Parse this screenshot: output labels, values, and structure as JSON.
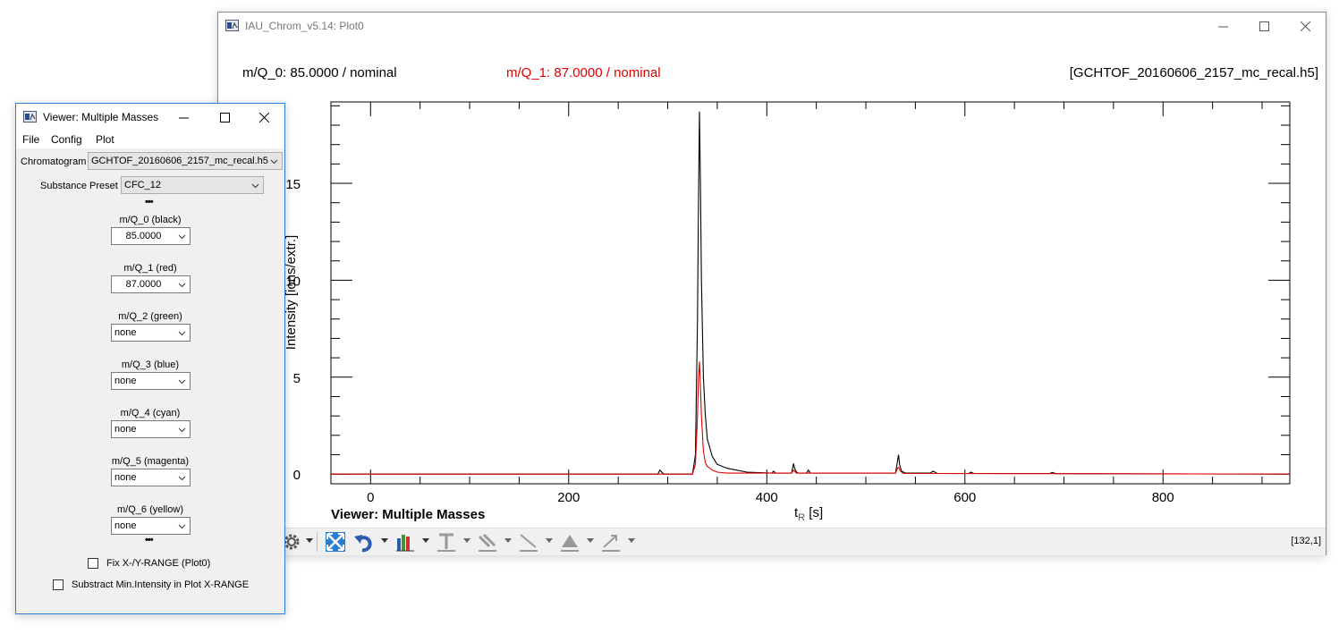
{
  "plot_window": {
    "title": "IAU_Chrom_v5.14: Plot0",
    "header": {
      "mq0_text": "m/Q_0: 85.0000 / nominal",
      "mq1_text": "m/Q_1: 87.0000 / nominal",
      "file_text": "[GCHTOF_20160606_2157_mc_recal.h5]"
    },
    "plot_caption": "Viewer: Multiple Masses",
    "xlabel_main": "t",
    "xlabel_sub": "R",
    "xlabel_unit": " [s]",
    "ylabel": "Intensity [ions/extr.]",
    "status_coords": "[132,1]",
    "colors": {
      "mq0": "#000000",
      "mq1": "#e00000"
    },
    "toolbar_icons": [
      "gear-icon",
      "zoom-fit-icon",
      "undo-icon",
      "bar-chart-icon",
      "text-tool-icon",
      "paint-tool-icon",
      "line-tool-icon",
      "shape-tool-icon",
      "arrow-tool-icon"
    ]
  },
  "chart_data": {
    "type": "line",
    "title": "",
    "xlabel": "tR [s]",
    "ylabel": "Intensity [ions/extr.]",
    "xlim": [
      -40,
      928
    ],
    "ylim": [
      -0.5,
      19.2
    ],
    "x_ticks": [
      0,
      200,
      400,
      600,
      800
    ],
    "y_ticks": [
      0,
      5,
      10,
      15
    ],
    "series": [
      {
        "name": "m/Q_0: 85.0000 / nominal",
        "color": "#000000",
        "x": [
          -40,
          290,
          292,
          294,
          296,
          325,
          328,
          330,
          331,
          332,
          333,
          334,
          336,
          338,
          340,
          345,
          350,
          360,
          380,
          405,
          407,
          409,
          425,
          427,
          428,
          430,
          432,
          440,
          442,
          444,
          530,
          532,
          533,
          534,
          536,
          540,
          565,
          568,
          572,
          604,
          606,
          609,
          686,
          688,
          692,
          928
        ],
        "y": [
          0.0,
          0.0,
          0.2,
          0.1,
          0.0,
          0.0,
          1.0,
          8.0,
          14.0,
          18.7,
          15.0,
          10.0,
          5.0,
          3.0,
          1.8,
          0.9,
          0.5,
          0.3,
          0.1,
          0.05,
          0.15,
          0.05,
          0.05,
          0.55,
          0.3,
          0.1,
          0.05,
          0.05,
          0.2,
          0.05,
          0.05,
          0.7,
          1.0,
          0.5,
          0.15,
          0.05,
          0.05,
          0.15,
          0.03,
          0.03,
          0.1,
          0.03,
          0.03,
          0.08,
          0.02,
          0.0
        ]
      },
      {
        "name": "m/Q_1: 87.0000 / nominal",
        "color": "#e00000",
        "x": [
          -40,
          325,
          328,
          330,
          331,
          332,
          333,
          334,
          336,
          338,
          340,
          345,
          350,
          360,
          425,
          427,
          430,
          530,
          532,
          533,
          535,
          538,
          700,
          928
        ],
        "y": [
          0.0,
          0.0,
          0.5,
          3.0,
          5.0,
          5.8,
          4.5,
          3.0,
          1.2,
          0.6,
          0.4,
          0.2,
          0.1,
          0.05,
          0.05,
          0.2,
          0.05,
          0.05,
          0.3,
          0.35,
          0.15,
          0.03,
          0.02,
          0.0
        ]
      }
    ]
  },
  "viewer_window": {
    "title": "Viewer: Multiple Masses",
    "menu": [
      "File",
      "Config",
      "Plot"
    ],
    "chromatogram_label": "Chromatogram",
    "chromatogram_value": "GCHTOF_20160606_2157_mc_recal.h5",
    "substance_preset_label": "Substance Preset",
    "substance_preset_value": "CFC_12",
    "dots_top": "•••",
    "dots_bottom": "•••",
    "mass_selectors": [
      {
        "label": "m/Q_0 (black)",
        "value": "85.0000"
      },
      {
        "label": "m/Q_1 (red)",
        "value": "87.0000"
      },
      {
        "label": "m/Q_2 (green)",
        "value": "none"
      },
      {
        "label": "m/Q_3 (blue)",
        "value": "none"
      },
      {
        "label": "m/Q_4 (cyan)",
        "value": "none"
      },
      {
        "label": "m/Q_5 (magenta)",
        "value": "none"
      },
      {
        "label": "m/Q_6 (yellow)",
        "value": "none"
      }
    ],
    "fix_range_label": "Fix X-/Y-RANGE (Plot0)",
    "subtract_label": "Substract Min.Intensity in Plot X-RANGE"
  }
}
